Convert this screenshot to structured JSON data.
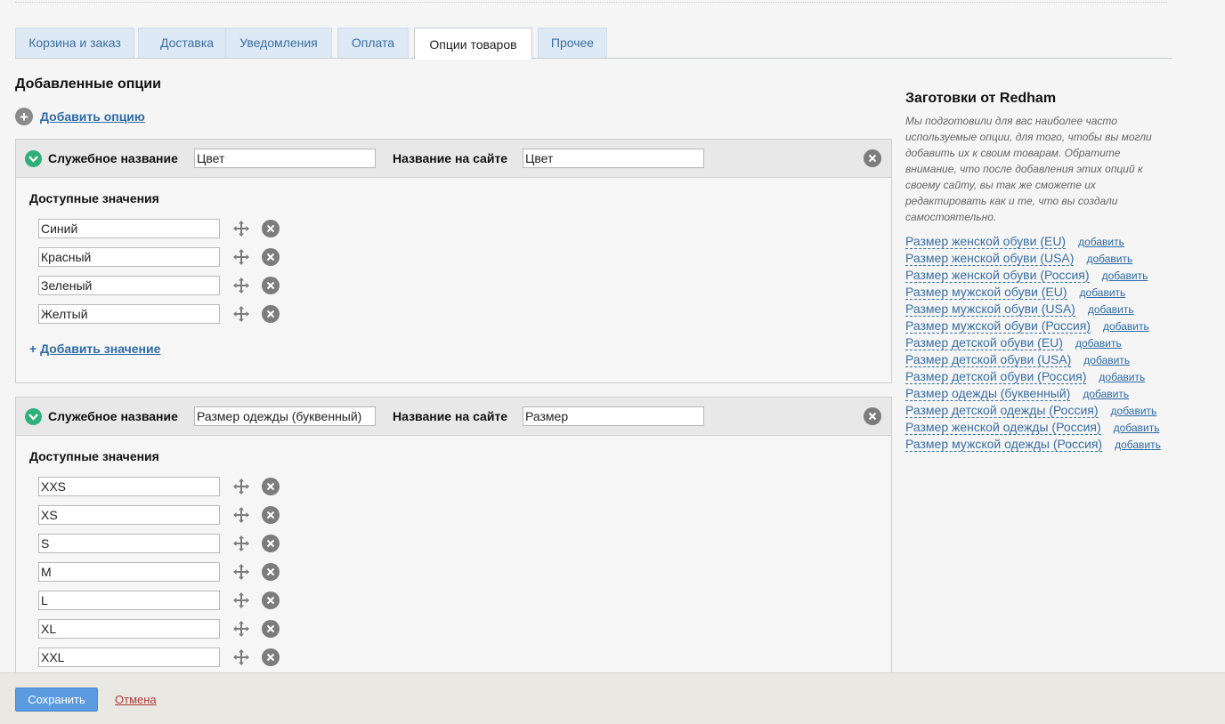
{
  "tabs": [
    {
      "label": "Корзина и заказ",
      "active": false
    },
    {
      "label": "Доставка",
      "active": false
    },
    {
      "label": "Уведомления",
      "active": false
    },
    {
      "label": "Оплата",
      "active": false
    },
    {
      "label": "Опции товаров",
      "active": true
    },
    {
      "label": "Прочее",
      "active": false
    }
  ],
  "main": {
    "title": "Добавленные опции",
    "add_option_label": "Добавить опцию",
    "add_option_icon": "plus-circle-icon"
  },
  "options": [
    {
      "service_name_label": "Служебное название",
      "service_name_value": "Цвет",
      "site_name_label": "Название на сайте",
      "site_name_value": "Цвет",
      "values_title": "Доступные значения",
      "values": [
        "Синий",
        "Красный",
        "Зеленый",
        "Желтый"
      ],
      "add_value_prefix": "+",
      "add_value_label": "Добавить значение"
    },
    {
      "service_name_label": "Служебное название",
      "service_name_value": "Размер одежды (буквенный)",
      "site_name_label": "Название на сайте",
      "site_name_value": "Размер",
      "values_title": "Доступные значения",
      "values": [
        "XXS",
        "XS",
        "S",
        "M",
        "L",
        "XL",
        "XXL"
      ]
    }
  ],
  "sidebar": {
    "title": "Заготовки от Redham",
    "description": "Мы подготовили для вас наиболее часто используемые опции, для того, чтобы вы могли добавить их к своим товарам. Обратите внимание, что после добавления этих опций к своему сайту, вы так же сможете их редактировать как и те, что вы создали самостоятельно.",
    "add_label": "добавить",
    "presets": [
      "Размер женской обуви (EU)",
      "Размер женской обуви (USA)",
      "Размер женской обуви (Россия)",
      "Размер мужской обуви (EU)",
      "Размер мужской обуви (USA)",
      "Размер мужской обуви (Россия)",
      "Размер детской обуви (EU)",
      "Размер детской обуви (USA)",
      "Размер детской обуви (Россия)",
      "Размер одежды (буквенный)",
      "Размер детской одежды (Россия)",
      "Размер женской одежды (Россия)",
      "Размер мужской одежды (Россия)"
    ]
  },
  "footer": {
    "save_label": "Сохранить",
    "cancel_label": "Отмена"
  },
  "colors": {
    "accent": "#5c9be0",
    "link": "#2f6aa8",
    "check": "#2fb079",
    "cancel": "#b03b3b"
  }
}
